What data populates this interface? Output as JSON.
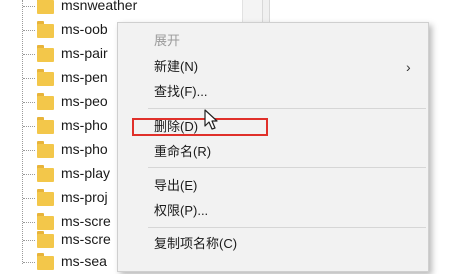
{
  "tree": {
    "items": [
      {
        "label": "msnweather"
      },
      {
        "label": "ms-oob"
      },
      {
        "label": "ms-pair"
      },
      {
        "label": "ms-pen"
      },
      {
        "label": "ms-peo"
      },
      {
        "label": "ms-pho"
      },
      {
        "label": "ms-pho"
      },
      {
        "label": "ms-play"
      },
      {
        "label": "ms-proj"
      },
      {
        "label": "ms-scre"
      },
      {
        "label": "ms-scre"
      },
      {
        "label": "ms-sea"
      }
    ]
  },
  "context_menu": {
    "expand": "展开",
    "new": "新建(N)",
    "new_arrow": "›",
    "find": "查找(F)...",
    "delete": "删除(D)",
    "rename": "重命名(R)",
    "export": "导出(E)",
    "permissions": "权限(P)...",
    "copy_key_name": "复制项名称(C)"
  },
  "colors": {
    "highlight_box": "#e0302a",
    "folder": "#f3c74a"
  }
}
